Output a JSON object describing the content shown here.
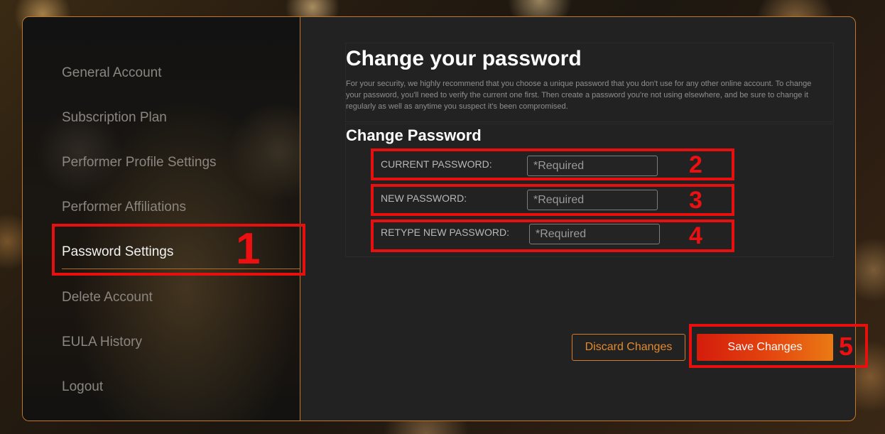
{
  "sidebar": {
    "items": [
      {
        "label": "General Account"
      },
      {
        "label": "Subscription Plan"
      },
      {
        "label": "Performer Profile Settings"
      },
      {
        "label": "Performer Affiliations"
      },
      {
        "label": "Password Settings",
        "active": true
      },
      {
        "label": "Delete Account"
      },
      {
        "label": "EULA History"
      },
      {
        "label": "Logout"
      }
    ]
  },
  "main": {
    "title": "Change your password",
    "description": "For your security, we highly recommend that you choose a unique password that you don't use for any other online account. To change your password, you'll need to verify the current one first. Then create a password you're not using elsewhere, and be sure to change it regularly as well as anytime you suspect it's been compromised.",
    "section_title": "Change Password",
    "fields": [
      {
        "label": "CURRENT PASSWORD:",
        "placeholder": "*Required",
        "value": ""
      },
      {
        "label": "NEW PASSWORD:",
        "placeholder": "*Required",
        "value": ""
      },
      {
        "label": "RETYPE NEW PASSWORD:",
        "placeholder": "*Required",
        "value": ""
      }
    ],
    "discard_label": "Discard Changes",
    "save_label": "Save Changes"
  },
  "annotations": [
    "1",
    "2",
    "3",
    "4",
    "5"
  ],
  "colors": {
    "accent_orange": "#e48a2e",
    "save_gradient_start": "#d41c0c",
    "save_gradient_end": "#ea7a14",
    "annotation_red": "#e8100e"
  }
}
